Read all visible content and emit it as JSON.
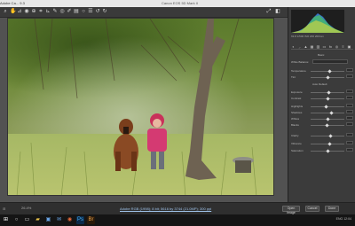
{
  "window": {
    "title": "Adobe Ca... 9.3",
    "center_title": "Canon EOS 5D Mark II"
  },
  "toolbar": {
    "tools": [
      "zoom-icon",
      "hand-icon",
      "white-balance-icon",
      "color-sampler-icon",
      "target-adjust-icon",
      "crop-icon",
      "straighten-icon",
      "spot-removal-icon",
      "red-eye-icon",
      "adjustment-brush-icon",
      "graduated-filter-icon",
      "radial-filter-icon",
      "preferences-icon",
      "rotate-left-icon",
      "rotate-right-icon"
    ]
  },
  "panel": {
    "camera_info": "f/2.8   1/500   ISO 200   200mm",
    "tabs": [
      "basic-tab",
      "tone-curve-tab",
      "detail-tab",
      "hsl-tab",
      "split-toning-tab",
      "lens-tab",
      "effects-tab",
      "camera-calibration-tab",
      "presets-tab",
      "snapshots-tab"
    ],
    "section_title": "Basic",
    "controls": [
      {
        "label": "White Balance:",
        "type": "select"
      },
      {
        "label": "Temperature",
        "type": "slider",
        "pos": 0.55
      },
      {
        "label": "Tint",
        "type": "slider",
        "pos": 0.5
      },
      {
        "label": "Auto    Default",
        "type": "text"
      },
      {
        "label": "Exposure",
        "type": "slider",
        "pos": 0.52
      },
      {
        "label": "Contrast",
        "type": "slider",
        "pos": 0.5
      },
      {
        "label": "Highlights",
        "type": "slider",
        "pos": 0.45
      },
      {
        "label": "Shadows",
        "type": "slider",
        "pos": 0.58
      },
      {
        "label": "Whites",
        "type": "slider",
        "pos": 0.5
      },
      {
        "label": "Blacks",
        "type": "slider",
        "pos": 0.48
      },
      {
        "label": "Clarity",
        "type": "slider",
        "pos": 0.55
      },
      {
        "label": "Vibrance",
        "type": "slider",
        "pos": 0.53
      },
      {
        "label": "Saturation",
        "type": "slider",
        "pos": 0.5
      }
    ]
  },
  "bottom": {
    "zoom": "26.4%",
    "workflow_link": "Adobe RGB (1998); 8 bit; 5616 by 3744 (21.0MP); 300 ppi",
    "buttons": [
      "Save Image...",
      "Open Image",
      "Cancel",
      "Done"
    ]
  },
  "taskbar": {
    "icons": [
      "windows-start-icon",
      "search-icon",
      "task-view-icon",
      "file-explorer-icon",
      "store-icon",
      "mail-icon",
      "browser-icon",
      "photoshop-icon",
      "bridge-icon"
    ],
    "right": "ENG  12:04"
  },
  "colors": {
    "accent": "#4a8fd8",
    "panel_bg": "#3b3b3b"
  }
}
